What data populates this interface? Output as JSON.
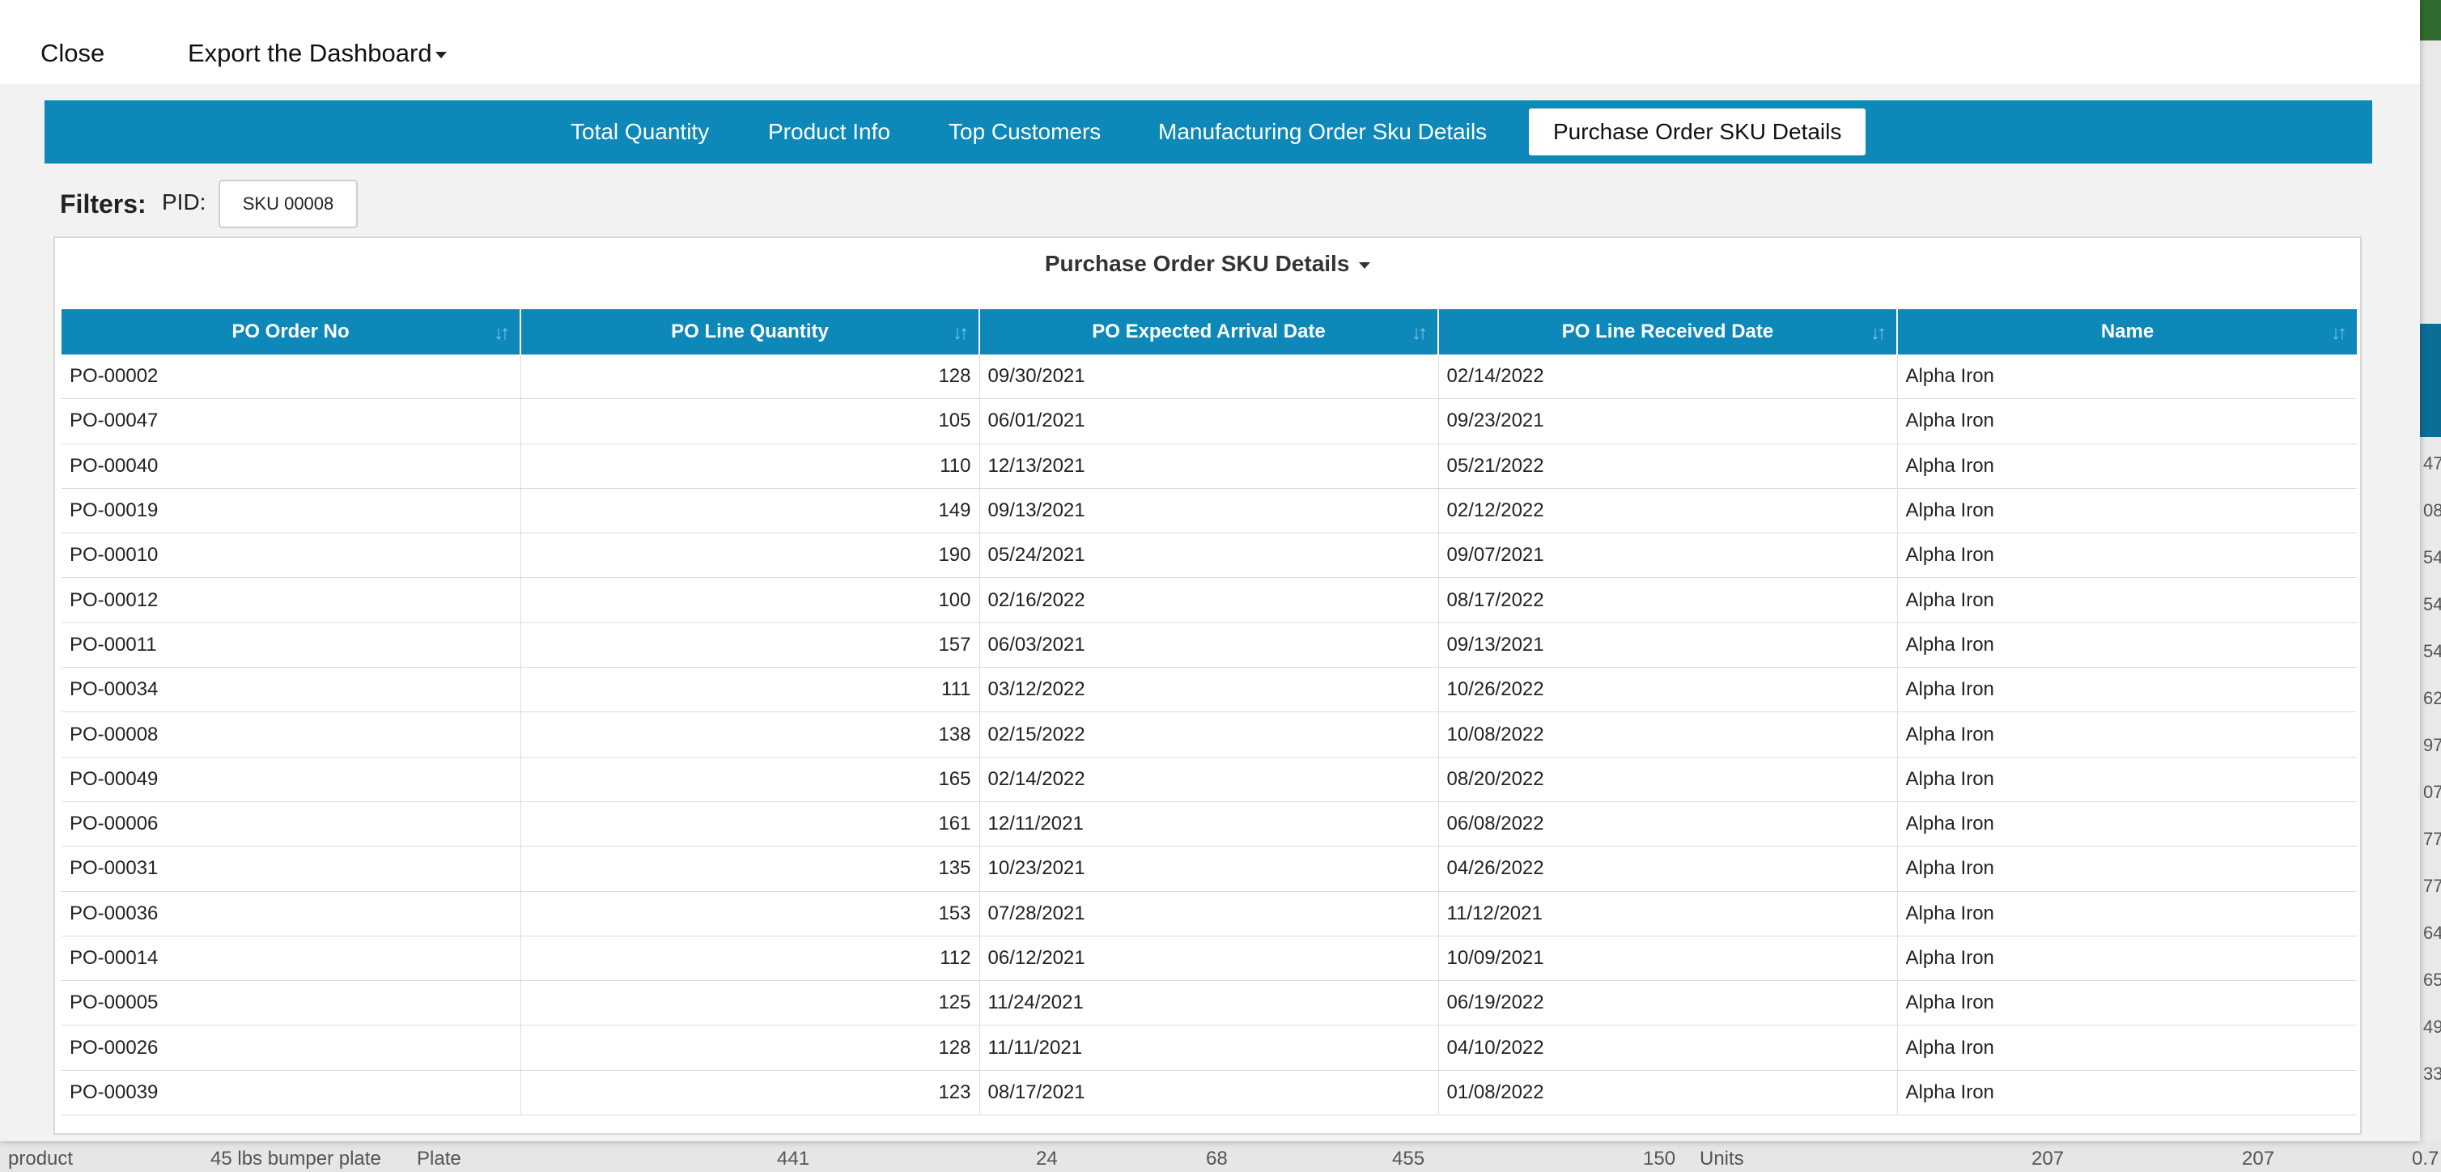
{
  "header": {
    "close_label": "Close",
    "export_label": "Export the Dashboard"
  },
  "tabs": [
    {
      "label": "Total Quantity",
      "active": false
    },
    {
      "label": "Product Info",
      "active": false
    },
    {
      "label": "Top Customers",
      "active": false
    },
    {
      "label": "Manufacturing Order Sku Details",
      "active": false
    },
    {
      "label": "Purchase Order SKU Details",
      "active": true
    }
  ],
  "filters": {
    "label": "Filters:",
    "pid_label": "PID:",
    "pid_value": "SKU 00008"
  },
  "panel": {
    "title": "Purchase Order SKU Details"
  },
  "table": {
    "columns": [
      "PO Order No",
      "PO Line Quantity",
      "PO Expected Arrival Date",
      "PO Line Received Date",
      "Name"
    ],
    "rows": [
      [
        "PO-00002",
        "128",
        "09/30/2021",
        "02/14/2022",
        "Alpha Iron"
      ],
      [
        "PO-00047",
        "105",
        "06/01/2021",
        "09/23/2021",
        "Alpha Iron"
      ],
      [
        "PO-00040",
        "110",
        "12/13/2021",
        "05/21/2022",
        "Alpha Iron"
      ],
      [
        "PO-00019",
        "149",
        "09/13/2021",
        "02/12/2022",
        "Alpha Iron"
      ],
      [
        "PO-00010",
        "190",
        "05/24/2021",
        "09/07/2021",
        "Alpha Iron"
      ],
      [
        "PO-00012",
        "100",
        "02/16/2022",
        "08/17/2022",
        "Alpha Iron"
      ],
      [
        "PO-00011",
        "157",
        "06/03/2021",
        "09/13/2021",
        "Alpha Iron"
      ],
      [
        "PO-00034",
        "111",
        "03/12/2022",
        "10/26/2022",
        "Alpha Iron"
      ],
      [
        "PO-00008",
        "138",
        "02/15/2022",
        "10/08/2022",
        "Alpha Iron"
      ],
      [
        "PO-00049",
        "165",
        "02/14/2022",
        "08/20/2022",
        "Alpha Iron"
      ],
      [
        "PO-00006",
        "161",
        "12/11/2021",
        "06/08/2022",
        "Alpha Iron"
      ],
      [
        "PO-00031",
        "135",
        "10/23/2021",
        "04/26/2022",
        "Alpha Iron"
      ],
      [
        "PO-00036",
        "153",
        "07/28/2021",
        "11/12/2021",
        "Alpha Iron"
      ],
      [
        "PO-00014",
        "112",
        "06/12/2021",
        "10/09/2021",
        "Alpha Iron"
      ],
      [
        "PO-00005",
        "125",
        "11/24/2021",
        "06/19/2022",
        "Alpha Iron"
      ],
      [
        "PO-00026",
        "128",
        "11/11/2021",
        "04/10/2022",
        "Alpha Iron"
      ],
      [
        "PO-00039",
        "123",
        "08/17/2021",
        "01/08/2022",
        "Alpha Iron"
      ]
    ]
  },
  "background": {
    "side_numbers": [
      "47",
      "08",
      "54",
      "54",
      "54",
      "62",
      "97",
      "07",
      "77",
      "77",
      "64",
      "65",
      "49",
      "33"
    ],
    "bottom_row": [
      "product",
      "45 lbs bumper plate",
      "Plate",
      "441",
      "24",
      "68",
      "455",
      "150",
      "Units",
      "207",
      "207",
      "0.7"
    ]
  },
  "colors": {
    "accent": "#0d88b8",
    "overlay_bg": "#f2f2f2"
  }
}
